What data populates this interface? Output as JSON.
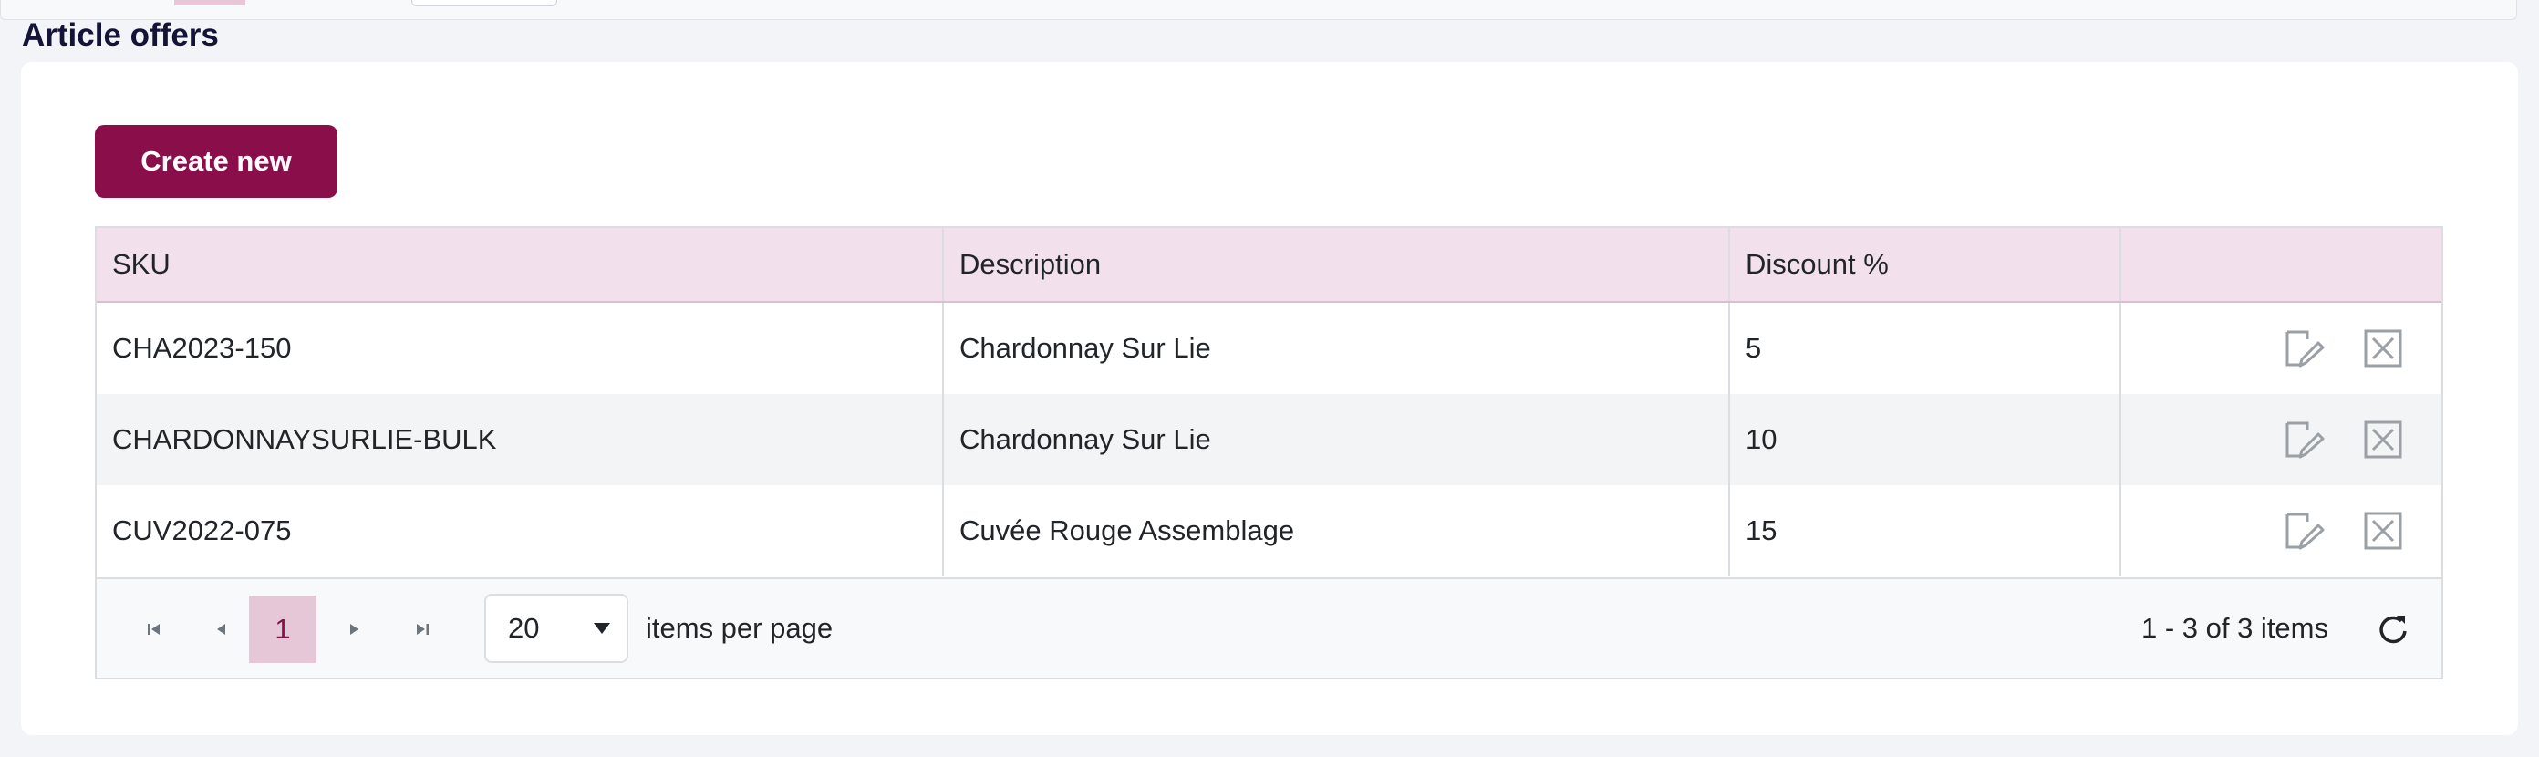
{
  "section": {
    "title": "Article offers"
  },
  "toolbar": {
    "create_label": "Create new"
  },
  "table": {
    "headers": {
      "sku": "SKU",
      "description": "Description",
      "discount": "Discount %"
    },
    "rows": [
      {
        "sku": "CHA2023-150",
        "description": "Chardonnay Sur Lie",
        "discount": "5"
      },
      {
        "sku": "CHARDONNAYSURLIE-BULK",
        "description": "Chardonnay Sur Lie",
        "discount": "10"
      },
      {
        "sku": "CUV2022-075",
        "description": "Cuvée Rouge Assemblage",
        "discount": "15"
      }
    ]
  },
  "pager": {
    "current_page": "1",
    "page_size": "20",
    "page_size_label": "items per page",
    "info": "1 - 3 of 3 items"
  },
  "icons": {
    "edit": "edit-icon",
    "delete": "delete-icon",
    "first": "first-page-icon",
    "prev": "previous-page-icon",
    "next": "next-page-icon",
    "last": "last-page-icon",
    "refresh": "refresh-icon",
    "dropdown": "chevron-down-icon"
  },
  "colors": {
    "brand": "#8a0e4a",
    "header_bg": "#f2e1ec",
    "title": "#141438"
  }
}
